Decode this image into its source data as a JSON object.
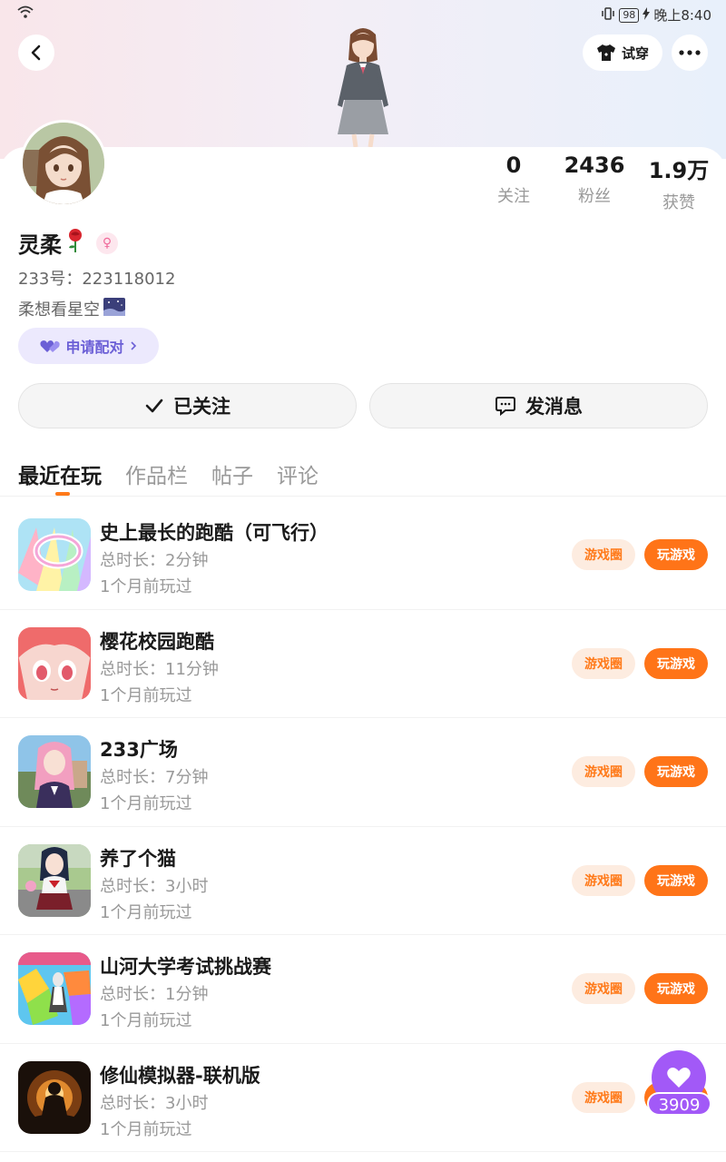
{
  "status_bar": {
    "battery": "98",
    "time": "晚上8:40"
  },
  "header": {
    "tryon_label": "试穿"
  },
  "profile": {
    "stats": [
      {
        "value": "0",
        "label": "关注"
      },
      {
        "value": "2436",
        "label": "粉丝"
      },
      {
        "value": "1.9万",
        "label": "获赞"
      }
    ],
    "nickname": "灵柔",
    "uid_label": "233号：",
    "uid": "223118012",
    "bio": "柔想看星空",
    "pair_label": "申请配对"
  },
  "actions": {
    "followed_label": "已关注",
    "message_label": "发消息"
  },
  "tabs": [
    "最近在玩",
    "作品栏",
    "帖子",
    "评论"
  ],
  "games": [
    {
      "name": "史上最长的跑酷（可飞行）",
      "duration": "总时长：2分钟",
      "last_played": "1个月前玩过",
      "icon": "rainbow-spiral-icon"
    },
    {
      "name": "樱花校园跑酷",
      "duration": "总时长：11分钟",
      "last_played": "1个月前玩过",
      "icon": "anime-girl-icon"
    },
    {
      "name": "233广场",
      "duration": "总时长：7分钟",
      "last_played": "1个月前玩过",
      "icon": "pink-hair-girl-icon"
    },
    {
      "name": "养了个猫",
      "duration": "总时长：3小时",
      "last_played": "1个月前玩过",
      "icon": "school-girl-icon"
    },
    {
      "name": "山河大学考试挑战赛",
      "duration": "总时长：1分钟",
      "last_played": "1个月前玩过",
      "icon": "colorful-blocks-icon"
    },
    {
      "name": "修仙模拟器-联机版",
      "duration": "总时长：3小时",
      "last_played": "1个月前玩过",
      "icon": "meditating-monk-icon"
    }
  ],
  "game_buttons": {
    "circle": "游戏圈",
    "play": "玩游戏"
  },
  "float": {
    "count": "3909"
  },
  "colors": {
    "accent": "#ff7418",
    "purple": "#a259f7",
    "pair": "#6b5fd6"
  }
}
